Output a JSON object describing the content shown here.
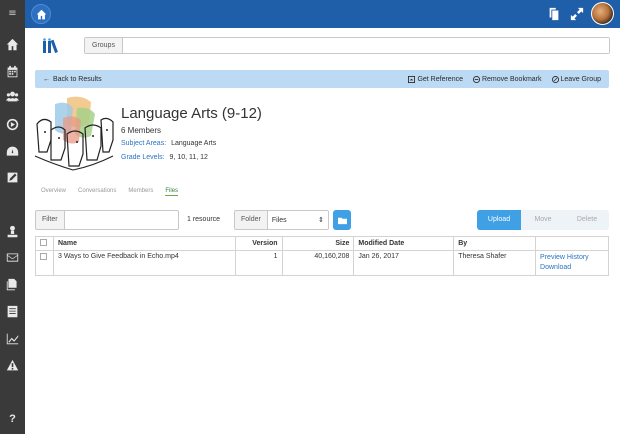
{
  "sidebar": {
    "icons": [
      "menu-icon",
      "home-icon",
      "calendar-icon",
      "users-icon",
      "play-icon",
      "dashboard-icon",
      "edit-icon",
      "upload-icon",
      "mail-icon",
      "documents-icon",
      "list-icon",
      "chart-icon",
      "warning-icon"
    ],
    "menu_glyph": "≡",
    "help_label": "?"
  },
  "topbar": {
    "icons": [
      "home-icon",
      "copy-icon",
      "expand-icon",
      "avatar"
    ],
    "brand_color": "#1f5ea8"
  },
  "search": {
    "label": "Groups",
    "value": "",
    "placeholder": ""
  },
  "crumbbar": {
    "back_label": "Back to Results",
    "actions": [
      {
        "label": "Get Reference",
        "icon": "reference-icon"
      },
      {
        "label": "Remove Bookmark",
        "icon": "minus-circle-icon"
      },
      {
        "label": "Leave Group",
        "icon": "ban-icon"
      }
    ]
  },
  "group": {
    "title": "Language Arts (9-12)",
    "members": "6 Members",
    "subject_key": "Subject Areas:",
    "subject_value": "Language Arts",
    "grade_key": "Grade Levels:",
    "grade_value": "9, 10, 11, 12"
  },
  "tabs": [
    "Overview",
    "Conversations",
    "Members",
    "Files"
  ],
  "active_tab": "Files",
  "toolbar": {
    "filter_label": "Filter",
    "filter_value": "",
    "clear_glyph": "✖",
    "resource_count": "1 resource",
    "folder_label": "Folder",
    "folder_value": "Files",
    "actions": [
      "Upload",
      "Move",
      "Delete"
    ]
  },
  "table": {
    "columns": [
      "",
      "Name",
      "Version",
      "Size",
      "Modified Date",
      "By",
      ""
    ],
    "rows": [
      {
        "name": "3 Ways to Give Feedback in Echo.mp4",
        "version": "1",
        "size": "40,160,208",
        "modified": "Jan 26, 2017",
        "by": "Theresa Shafer",
        "links": [
          "Preview History",
          "Download"
        ]
      }
    ]
  },
  "colors": {
    "accent": "#3fa0e6",
    "crumb_bg": "#bcdaf4",
    "sidebar_bg": "#3a3a3a",
    "link": "#2a74c2"
  }
}
